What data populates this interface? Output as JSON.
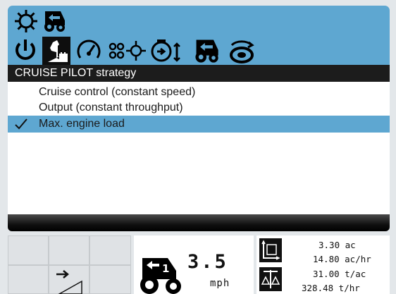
{
  "app": {
    "title_icons": [
      "gear-icon",
      "tractor-reverse-icon"
    ]
  },
  "tabs": [
    {
      "name": "power-icon",
      "active": false
    },
    {
      "name": "chess-knight-icon",
      "active": true
    },
    {
      "name": "speedometer-icon",
      "active": false
    },
    {
      "name": "threshing-icon",
      "active": false
    },
    {
      "name": "engine-limit-icon",
      "active": false
    },
    {
      "name": "tractor-reverse-icon",
      "active": false
    },
    {
      "name": "rotor-icon",
      "active": false
    }
  ],
  "header": {
    "title": "CRUISE PILOT strategy"
  },
  "options": [
    {
      "label": "Cruise control (constant speed)",
      "selected": false
    },
    {
      "label": "Output (constant throughput)",
      "selected": false
    },
    {
      "label": "Max. engine load",
      "selected": true
    }
  ],
  "speed": {
    "value": "3.5",
    "unit": "mph",
    "gear_icon": "tractor-gear-1-icon"
  },
  "performance": {
    "area": "3.30 ac",
    "area_rate": "14.80 ac/hr",
    "yield_per_area": "31.00 t/ac",
    "throughput": "328.48 t/hr"
  },
  "colors": {
    "accent": "#5ea7d1",
    "header_bg": "#1c1c1c",
    "panel_bg": "#ffffff"
  }
}
